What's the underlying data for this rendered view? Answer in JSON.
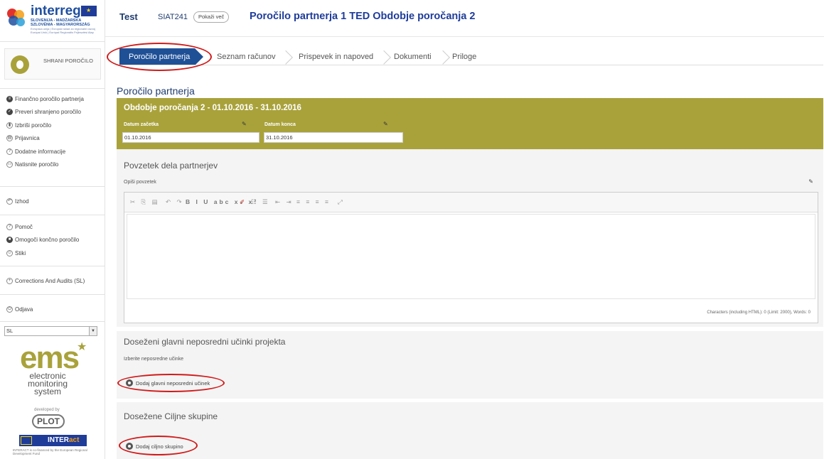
{
  "logo": {
    "word": "interreg",
    "sub1": "SLOVENIJA - MADŽARSKA SZLOVÉNIA - MAGYARORSZÁG",
    "sub2": "Evropska unija | Evropski sklad za regionalni razvoj Európai Unió | Európai Regionális Fejlesztési Alap"
  },
  "sidebar": {
    "save_label": "SHRANI POROČILO",
    "menu1": [
      {
        "label": "Finančno poročilo partnerja",
        "icon": "list-icon"
      },
      {
        "label": "Preveri shranjeno poročilo",
        "icon": "check-icon"
      },
      {
        "label": "Izbriši poročilo",
        "icon": "trash-icon"
      },
      {
        "label": "Prijavnica",
        "icon": "document-icon"
      },
      {
        "label": "Dodatne informacije",
        "icon": "info-icon"
      },
      {
        "label": "Natisnite poročilo",
        "icon": "print-icon"
      }
    ],
    "exit": "Izhod",
    "menu2": [
      {
        "label": "Pomoč",
        "icon": "help-icon"
      },
      {
        "label": "Omogoči končno poročilo",
        "icon": "final-report-icon"
      },
      {
        "label": "Stiki",
        "icon": "contacts-icon"
      }
    ],
    "corrections": "Corrections And Audits (SL)",
    "logout": "Odjava",
    "language": "SL",
    "ems": {
      "word": "ems",
      "sub": "electronic monitoring system",
      "developed_by": "developed by",
      "plot": "PLOT",
      "interact_a": "INTER",
      "interact_b": "act",
      "fine": "INTERACT is co-financed by the European Regional Development Fund"
    }
  },
  "header": {
    "project": "Test",
    "code": "SIAT241",
    "show_more": "Pokaži več",
    "title": "Poročilo partnerja 1 TED Obdobje poročanja 2"
  },
  "tabs": [
    "Poročilo partnerja",
    "Seznam računov",
    "Prispevek in napoved",
    "Dokumenti",
    "Priloge"
  ],
  "main": {
    "page_title": "Poročilo partnerja",
    "period": {
      "title": "Obdobje poročanja 2 - 01.10.2016 - 31.10.2016",
      "start_label": "Datum začetka",
      "start_value": "01.10.2016",
      "end_label": "Datum konca",
      "end_value": "31.10.2016"
    },
    "summary": {
      "title": "Povzetek dela partnerjev",
      "field_label": "Opiši povzetek",
      "char_count": "Characters (including HTML): 0 (Limit: 2000), Words: 0"
    },
    "outputs": {
      "title": "Doseženi glavni neposredni učinki projekta",
      "sub": "Izberite neposredne učinke",
      "add_label": "Dodaj glavni neposredni učinek"
    },
    "targets": {
      "title": "Dosežene Ciljne skupine",
      "add_label": "Dodaj ciljno skupino"
    }
  },
  "colors": {
    "accent_olive": "#a9a23b",
    "tab_active": "#1f5096",
    "title_blue": "#1f3c99",
    "highlight_red": "#d11a1a"
  }
}
